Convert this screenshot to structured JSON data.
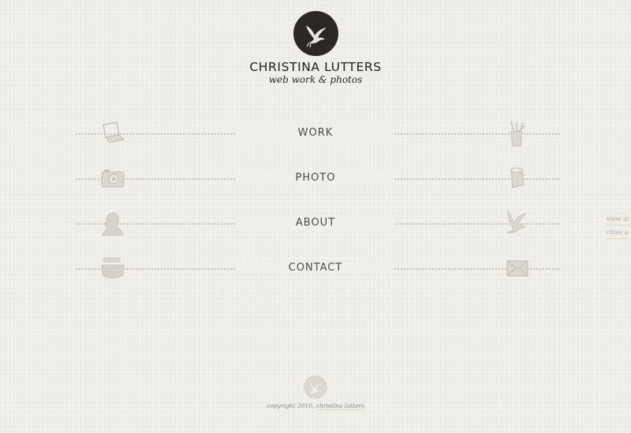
{
  "brand": {
    "name": "CHRISTINA LUTTERS",
    "tagline": "web work & photos",
    "logo_icon": "dove-icon"
  },
  "nav": {
    "items": [
      {
        "label": "WORK",
        "left_icon": "laptop-icon",
        "right_icon": "pencil-cup-icon"
      },
      {
        "label": "PHOTO",
        "left_icon": "camera-icon",
        "right_icon": "film-roll-icon"
      },
      {
        "label": "ABOUT",
        "left_icon": "woman-silhouette-icon",
        "right_icon": "dove-icon"
      },
      {
        "label": "CONTACT",
        "left_icon": "typewriter-icon",
        "right_icon": "envelope-icon"
      }
    ]
  },
  "side_links": {
    "view_all": "view all",
    "close_all": "close all"
  },
  "footer": {
    "copyright": "copyright 2010,",
    "author_link": "christina lutters",
    "icon": "dove-icon"
  },
  "colors": {
    "background": "#f1efea",
    "logo_circle": "#2a2725",
    "text": "#4d4a45",
    "link_underline": "#cfe0b8"
  }
}
